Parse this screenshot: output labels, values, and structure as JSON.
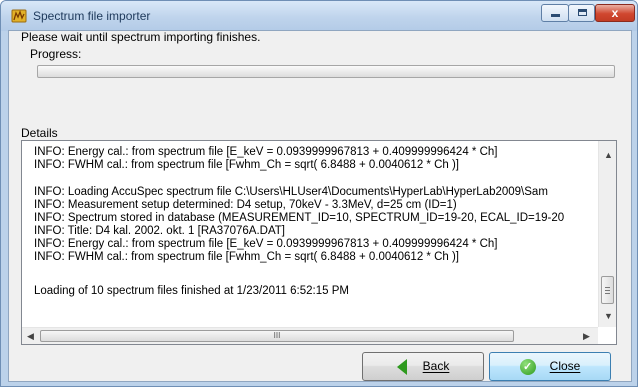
{
  "window": {
    "title": "Spectrum file importer",
    "app_icon": "hyperlab-app-icon",
    "controls": {
      "minimize": "minimize-icon",
      "maximize": "maximize-icon",
      "close": "close-icon",
      "close_glyph": "x"
    }
  },
  "prompt": "Please wait until spectrum importing finishes.",
  "progress": {
    "label": "Progress:",
    "fraction": 0.0
  },
  "details": {
    "label": "Details",
    "lines": [
      "INFO: Energy cal.: from spectrum file [E_keV = 0.0939999967813 + 0.409999996424 * Ch]",
      "INFO: FWHM cal.: from spectrum file [Fwhm_Ch = sqrt( 6.8488 + 0.0040612 * Ch )]",
      "",
      "INFO: Loading AccuSpec spectrum file C:\\Users\\HLUser4\\Documents\\HyperLab\\HyperLab2009\\Sam",
      "INFO: Measurement setup determined: D4 setup, 70keV - 3.3MeV, d=25 cm (ID=1)",
      "INFO: Spectrum stored in database (MEASUREMENT_ID=10, SPECTRUM_ID=19-20, ECAL_ID=19-20",
      "INFO: Title: D4 kal. 2002. okt. 1 [RA37076A.DAT]",
      "INFO: Energy cal.: from spectrum file [E_keV = 0.0939999967813 + 0.409999996424 * Ch]",
      "INFO: FWHM cal.: from spectrum file [Fwhm_Ch = sqrt( 6.8488 + 0.0040612 * Ch )]",
      "",
      "Loading of 10 spectrum files finished at 1/23/2011 6:52:15 PM"
    ],
    "hscroll_grip": "III"
  },
  "buttons": {
    "back": {
      "label": "Back",
      "icon": "back-arrow-icon"
    },
    "close": {
      "label": "Close",
      "icon": "checkmark-icon",
      "glyph": "✓"
    }
  },
  "colors": {
    "accent_green": "#2e9a1e",
    "title_text": "#1e395b",
    "close_red": "#c23b24"
  }
}
